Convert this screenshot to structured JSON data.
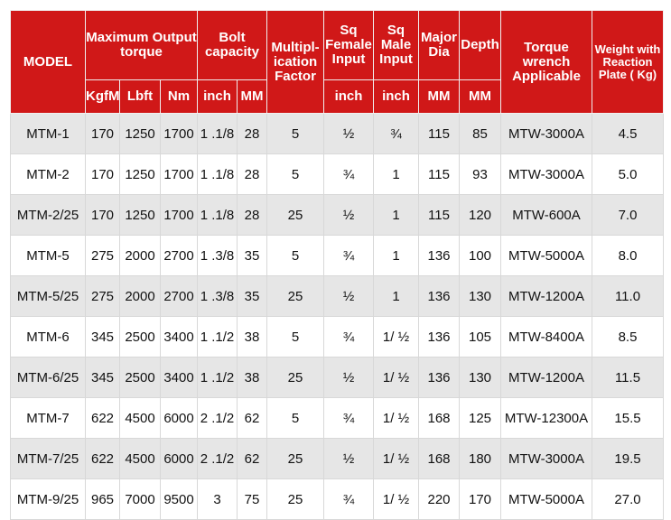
{
  "table": {
    "headers": {
      "model": "MODEL",
      "max_output_torque": "Maximum Output torque",
      "bolt_capacity": "Bolt capacity",
      "multiplication_factor": "Multipl-ication Factor",
      "sq_female_input": "Sq Female Input",
      "sq_male_input": "Sq Male Input",
      "major_dia": "Major Dia",
      "depth": "Depth",
      "torque_wrench": "Torque wrench Applicable",
      "weight": "Weight with Reaction Plate ( Kg)"
    },
    "units": {
      "kgfm": "KgfM",
      "lbft": "Lbft",
      "nm": "Nm",
      "bolt_inch": "inch",
      "bolt_mm": "MM",
      "female_inch": "inch",
      "male_inch": "inch",
      "dia_mm": "MM",
      "depth_mm": "MM"
    },
    "rows": [
      {
        "model": "MTM-1",
        "kgfm": "170",
        "lbft": "1250",
        "nm": "1700",
        "bolt_inch": "1 .1/8",
        "bolt_mm": "28",
        "factor": "5",
        "female": "½",
        "male": "¾",
        "dia": "115",
        "depth": "85",
        "wrench": "MTW-3000A",
        "weight": "4.5"
      },
      {
        "model": "MTM-2",
        "kgfm": "170",
        "lbft": "1250",
        "nm": "1700",
        "bolt_inch": "1 .1/8",
        "bolt_mm": "28",
        "factor": "5",
        "female": "¾",
        "male": "1",
        "dia": "115",
        "depth": "93",
        "wrench": "MTW-3000A",
        "weight": "5.0"
      },
      {
        "model": "MTM-2/25",
        "kgfm": "170",
        "lbft": "1250",
        "nm": "1700",
        "bolt_inch": "1 .1/8",
        "bolt_mm": "28",
        "factor": "25",
        "female": "½",
        "male": "1",
        "dia": "115",
        "depth": "120",
        "wrench": "MTW-600A",
        "weight": "7.0"
      },
      {
        "model": "MTM-5",
        "kgfm": "275",
        "lbft": "2000",
        "nm": "2700",
        "bolt_inch": "1 .3/8",
        "bolt_mm": "35",
        "factor": "5",
        "female": "¾",
        "male": "1",
        "dia": "136",
        "depth": "100",
        "wrench": "MTW-5000A",
        "weight": "8.0"
      },
      {
        "model": "MTM-5/25",
        "kgfm": "275",
        "lbft": "2000",
        "nm": "2700",
        "bolt_inch": "1 .3/8",
        "bolt_mm": "35",
        "factor": "25",
        "female": "½",
        "male": "1",
        "dia": "136",
        "depth": "130",
        "wrench": "MTW-1200A",
        "weight": "11.0"
      },
      {
        "model": "MTM-6",
        "kgfm": "345",
        "lbft": "2500",
        "nm": "3400",
        "bolt_inch": "1 .1/2",
        "bolt_mm": "38",
        "factor": "5",
        "female": "¾",
        "male": "1/ ½",
        "dia": "136",
        "depth": "105",
        "wrench": "MTW-8400A",
        "weight": "8.5"
      },
      {
        "model": "MTM-6/25",
        "kgfm": "345",
        "lbft": "2500",
        "nm": "3400",
        "bolt_inch": "1 .1/2",
        "bolt_mm": "38",
        "factor": "25",
        "female": "½",
        "male": "1/ ½",
        "dia": "136",
        "depth": "130",
        "wrench": "MTW-1200A",
        "weight": "11.5"
      },
      {
        "model": "MTM-7",
        "kgfm": "622",
        "lbft": "4500",
        "nm": "6000",
        "bolt_inch": "2 .1/2",
        "bolt_mm": "62",
        "factor": "5",
        "female": "¾",
        "male": "1/ ½",
        "dia": "168",
        "depth": "125",
        "wrench": "MTW-12300A",
        "weight": "15.5"
      },
      {
        "model": "MTM-7/25",
        "kgfm": "622",
        "lbft": "4500",
        "nm": "6000",
        "bolt_inch": "2 .1/2",
        "bolt_mm": "62",
        "factor": "25",
        "female": "½",
        "male": "1/ ½",
        "dia": "168",
        "depth": "180",
        "wrench": "MTW-3000A",
        "weight": "19.5"
      },
      {
        "model": "MTM-9/25",
        "kgfm": "965",
        "lbft": "7000",
        "nm": "9500",
        "bolt_inch": "3",
        "bolt_mm": "75",
        "factor": "25",
        "female": "¾",
        "male": "1/ ½",
        "dia": "220",
        "depth": "170",
        "wrench": "MTW-5000A",
        "weight": "27.0"
      }
    ]
  },
  "colors": {
    "header_bg": "#d01818",
    "header_text": "#ffffff",
    "row_alt_bg": "#e6e6e6",
    "row_bg": "#ffffff"
  }
}
